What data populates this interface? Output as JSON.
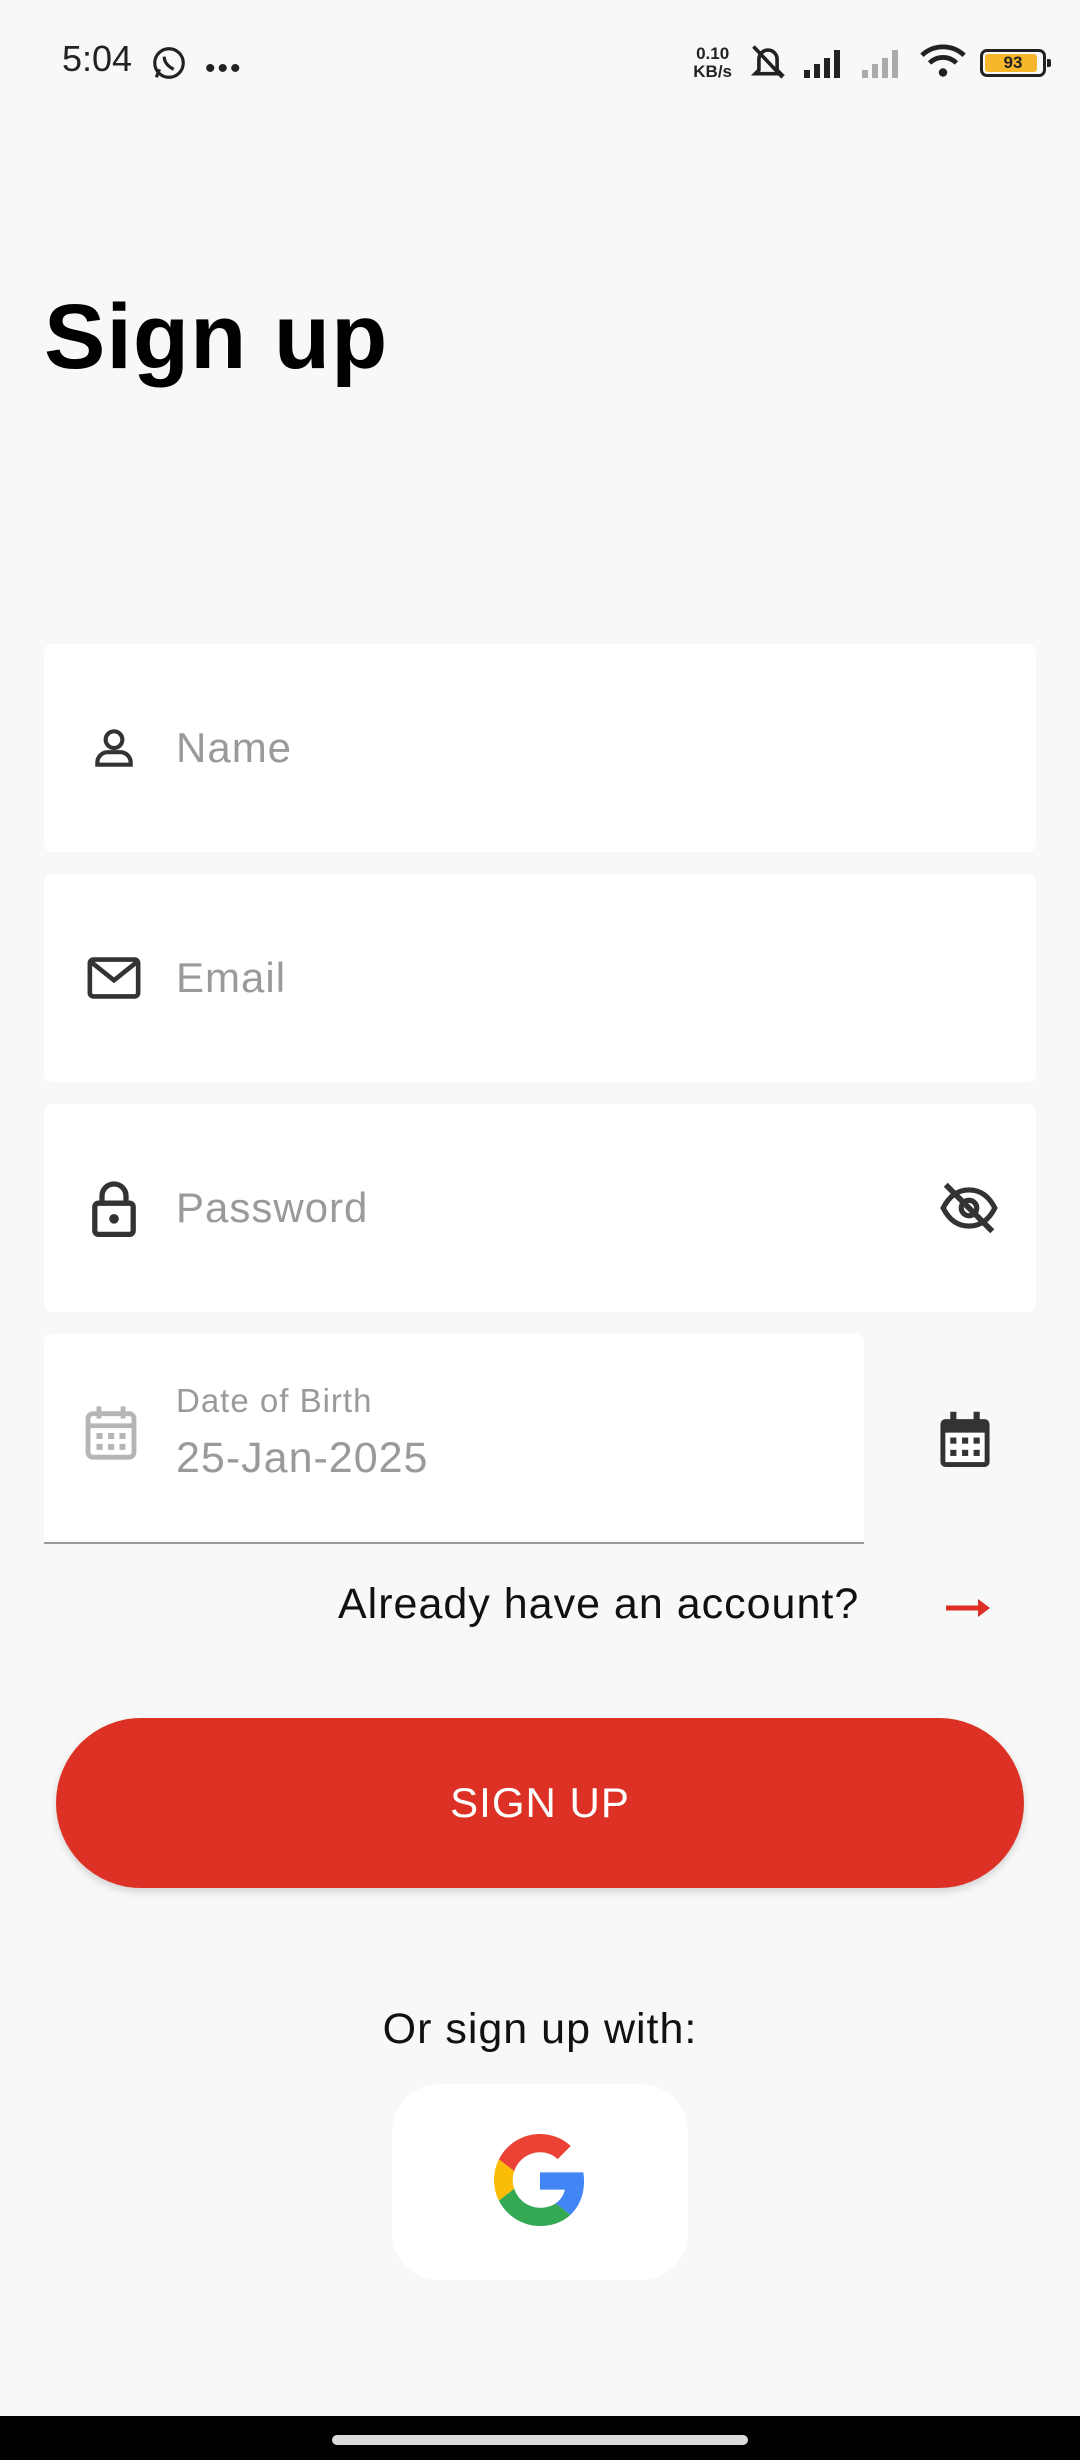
{
  "status_bar": {
    "time": "5:04",
    "speed_value": "0.10",
    "speed_unit": "KB/s",
    "battery": "93"
  },
  "page": {
    "title": "Sign up"
  },
  "form": {
    "name_placeholder": "Name",
    "email_placeholder": "Email",
    "password_placeholder": "Password",
    "dob_label": "Date of Birth",
    "dob_value": "25-Jan-2025"
  },
  "links": {
    "already_account": "Already have an account?"
  },
  "actions": {
    "signup_label": "SIGN UP",
    "or_signup_with": "Or sign up with:"
  },
  "colors": {
    "accent": "#dc3124",
    "background": "#f8f8f8",
    "placeholder": "#9a9a9a"
  }
}
